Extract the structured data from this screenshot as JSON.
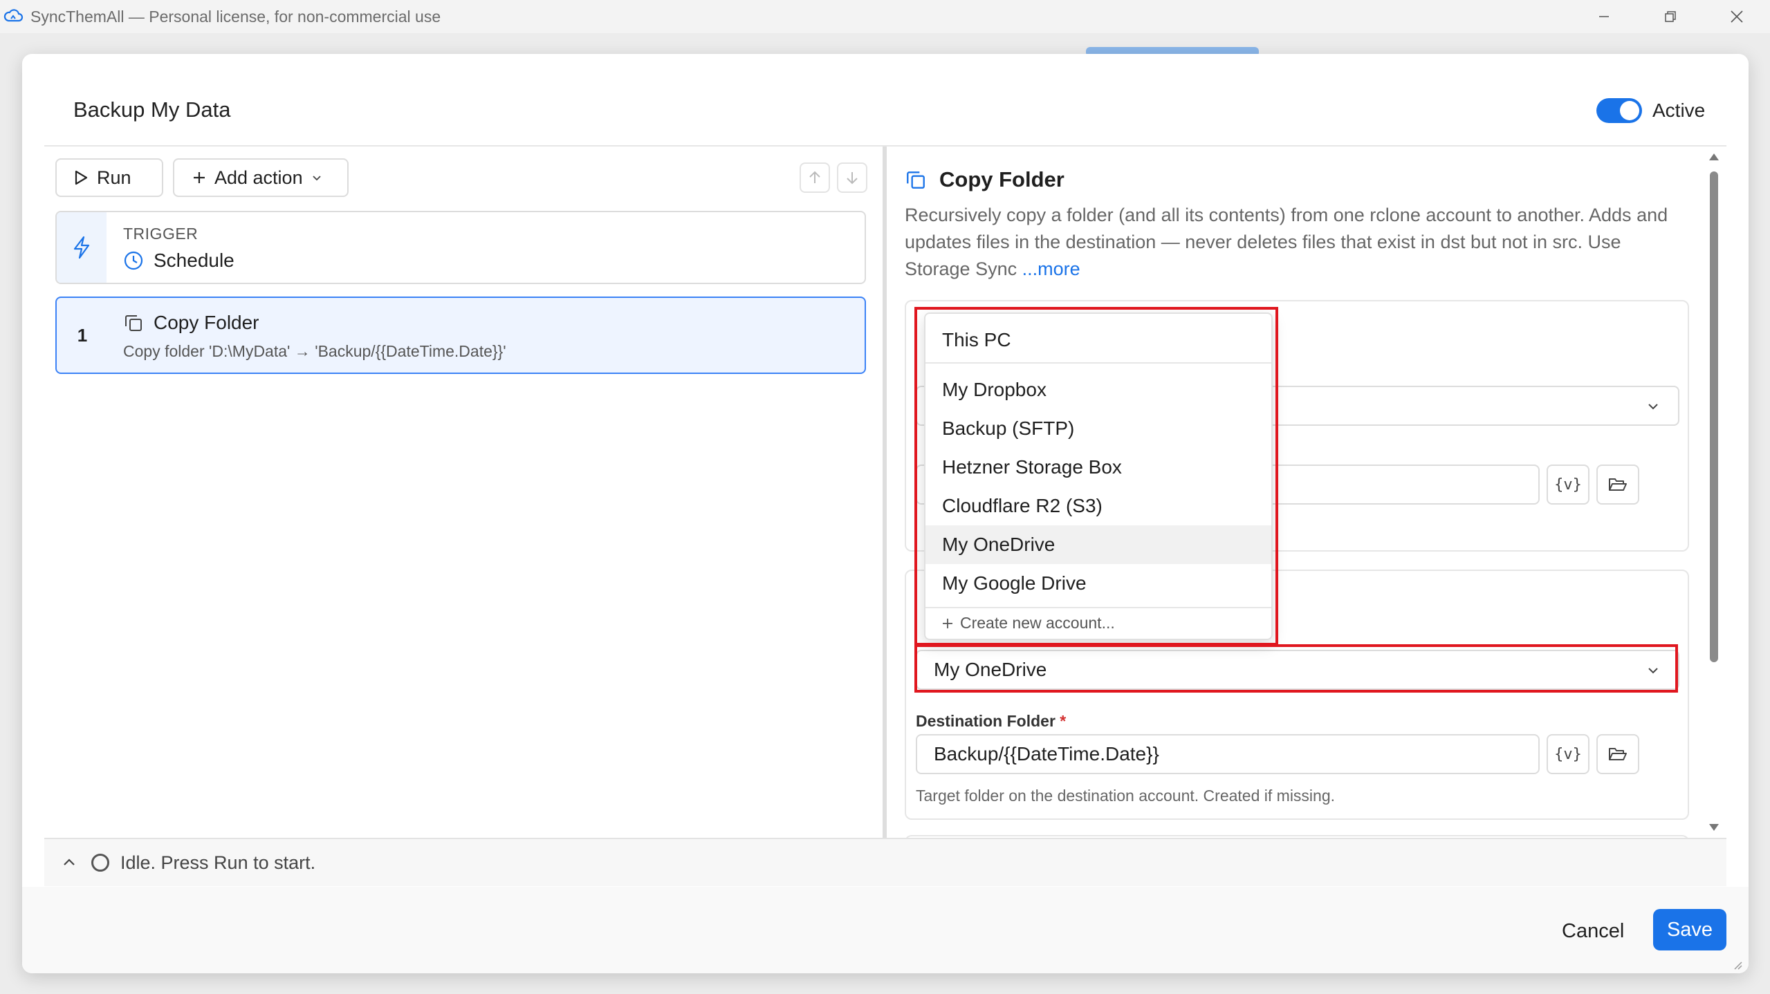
{
  "window": {
    "title": "SyncThemAll — Personal license, for non-commercial use",
    "app_icon": "cloud-sync-icon"
  },
  "dialog": {
    "title": "Backup My Data",
    "active_toggle": {
      "label": "Active",
      "on": true
    }
  },
  "toolbar": {
    "run_label": "Run",
    "add_action_label": "Add action"
  },
  "steps": {
    "trigger": {
      "kind": "TRIGGER",
      "value": "Schedule"
    },
    "items": [
      {
        "index": "1",
        "title": "Copy Folder",
        "subtitle": "Copy folder 'D:\\MyData' → 'Backup/{{DateTime.Date}}'",
        "selected": true
      }
    ]
  },
  "detail": {
    "title": "Copy Folder",
    "description": "Recursively copy a folder (and all its contents) from one rclone account to another. Adds and updates files in the destination — never deletes files that exist in dst but not in src. Use Storage Sync",
    "more_link": "...more",
    "variable_button": "{v}",
    "destination": {
      "account_value": "My OneDrive",
      "folder_label": "Destination Folder",
      "required_mark": "*",
      "folder_value": "Backup/{{DateTime.Date}}",
      "folder_hint": "Target folder on the destination account. Created if missing."
    }
  },
  "account_dropdown": {
    "items": [
      "This PC",
      "My Dropbox",
      "Backup (SFTP)",
      "Hetzner Storage Box",
      "Cloudflare R2 (S3)",
      "My OneDrive",
      "My Google Drive"
    ],
    "hovered": "My OneDrive",
    "create_label": "Create new account..."
  },
  "status": {
    "text": "Idle. Press Run to start."
  },
  "footer": {
    "cancel_label": "Cancel",
    "save_label": "Save"
  },
  "colors": {
    "accent": "#1a73e8",
    "highlight": "#e0171f"
  }
}
